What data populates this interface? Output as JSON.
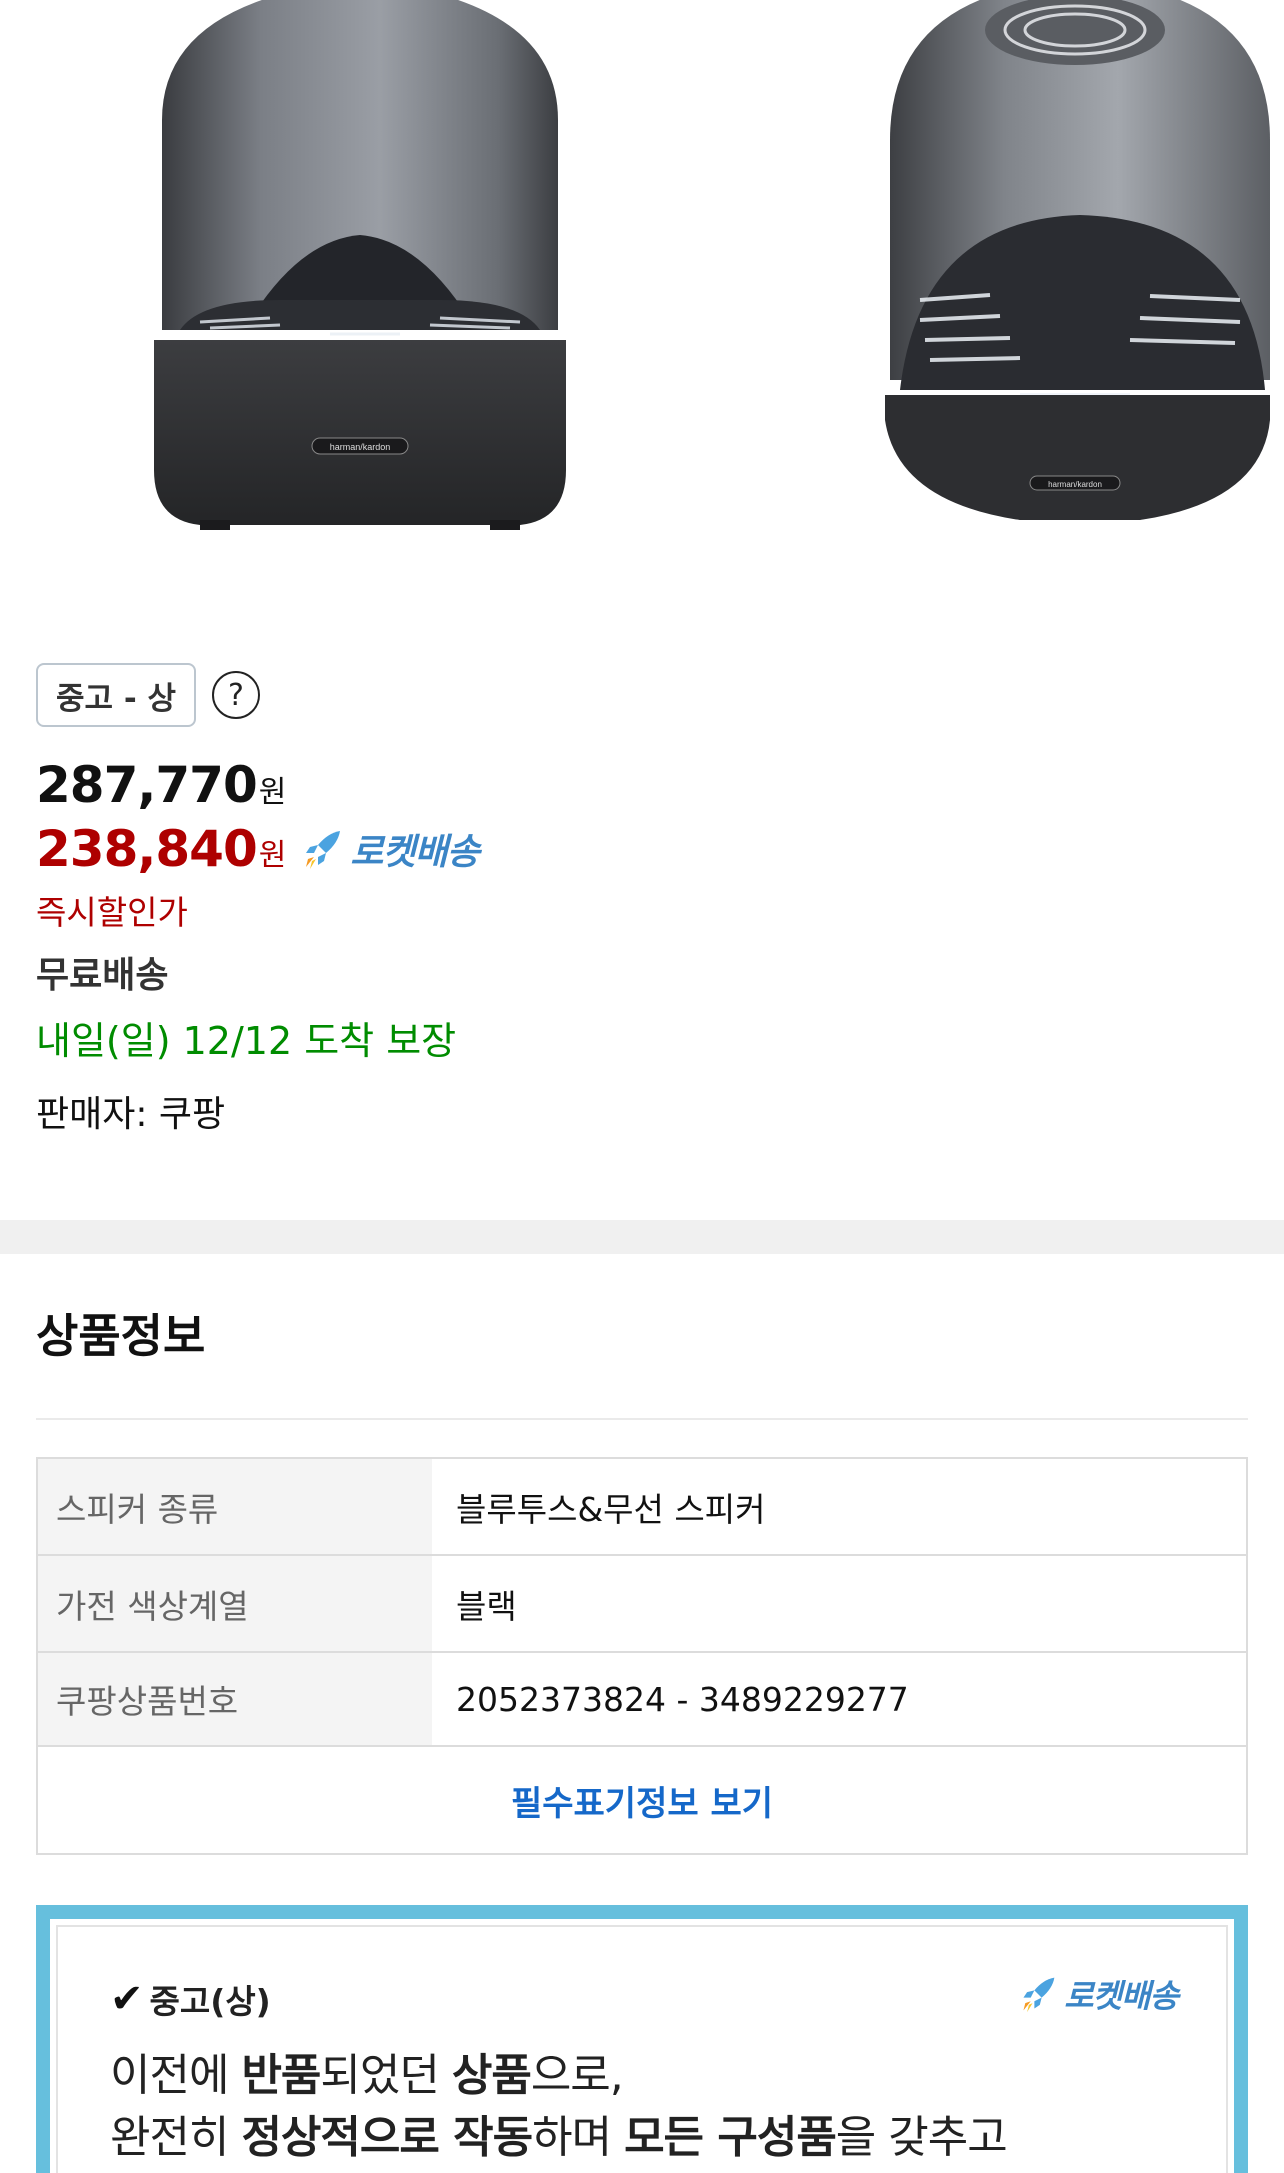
{
  "product": {
    "condition_badge": "중고 - 상",
    "help_icon": "?",
    "original_price": "287,770",
    "sale_price": "238,840",
    "currency_unit": "원",
    "rocket_label": "로켓배송",
    "discount_label": "즉시할인가",
    "shipping_label": "무료배송",
    "arrival_label": "내일(일) 12/12 도착 보장",
    "seller_label": "판매자: 쿠팡"
  },
  "product_info": {
    "title": "상품정보",
    "rows": [
      {
        "key": "스피커 종류",
        "value": "블루투스&무선 스피커"
      },
      {
        "key": "가전 색상계열",
        "value": "블랙"
      },
      {
        "key": "쿠팡상품번호",
        "value": "2052373824 - 3489229277"
      }
    ],
    "more_link": "필수표기정보 보기"
  },
  "used_notice": {
    "title": "중고(상)",
    "rocket_label": "로켓배송",
    "line1_a": "이전에 ",
    "line1_b": "반품",
    "line1_c": "되었던 ",
    "line1_d": "상품",
    "line1_e": "으로,",
    "line2_a": "완전히 ",
    "line2_b": "정상적으로 작동",
    "line2_c": "하며 ",
    "line2_d": "모든 구성품",
    "line2_e": "을 갖추고"
  },
  "gallery": {
    "brand_text_1": "harman/kardon",
    "brand_text_2": "harman/kardon"
  },
  "colors": {
    "sale_red": "#ae0000",
    "arrival_green": "#008c00",
    "link_blue": "#1568c9",
    "rocket_blue": "#3b85c6",
    "notice_border": "#66bfdd"
  }
}
